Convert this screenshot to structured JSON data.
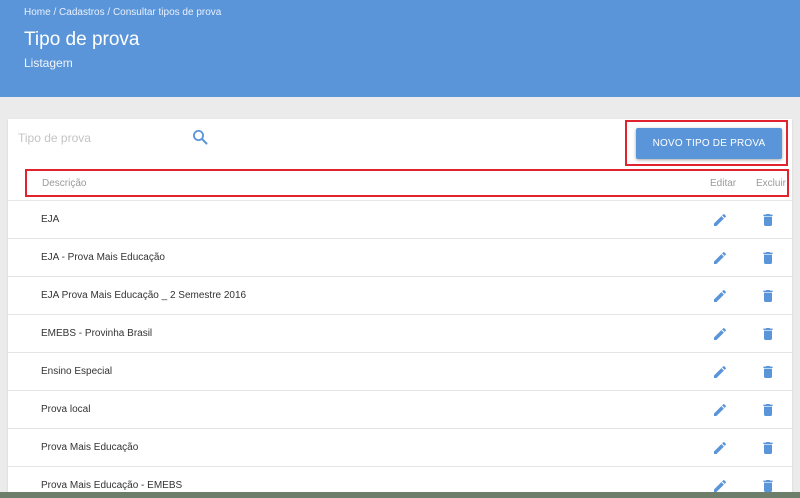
{
  "breadcrumb": {
    "home": "Home",
    "sep1": " / ",
    "cadastros": "Cadastros",
    "sep2": " / ",
    "current": "Consultar tipos de prova"
  },
  "header": {
    "title": "Tipo de prova",
    "subtitle": "Listagem"
  },
  "search": {
    "placeholder": "Tipo de prova",
    "value": ""
  },
  "actions": {
    "new_label": "NOVO TIPO DE PROVA"
  },
  "table": {
    "columns": {
      "description": "Descrição",
      "edit": "Editar",
      "delete": "Excluir"
    },
    "rows": [
      "EJA",
      "EJA - Prova Mais Educação",
      "EJA Prova Mais Educação _ 2 Semestre 2016",
      "EMEBS - Provinha Brasil",
      "Ensino Especial",
      "Prova local",
      "Prova Mais Educação",
      "Prova Mais Educação - EMEBS"
    ]
  },
  "colors": {
    "header_bg": "#5b95d9",
    "accent": "#5b95d9",
    "highlight": "#e0232e",
    "page_bg": "#ebebeb"
  },
  "icons": {
    "search": "search-icon",
    "edit": "pencil-icon",
    "delete": "trash-icon"
  }
}
